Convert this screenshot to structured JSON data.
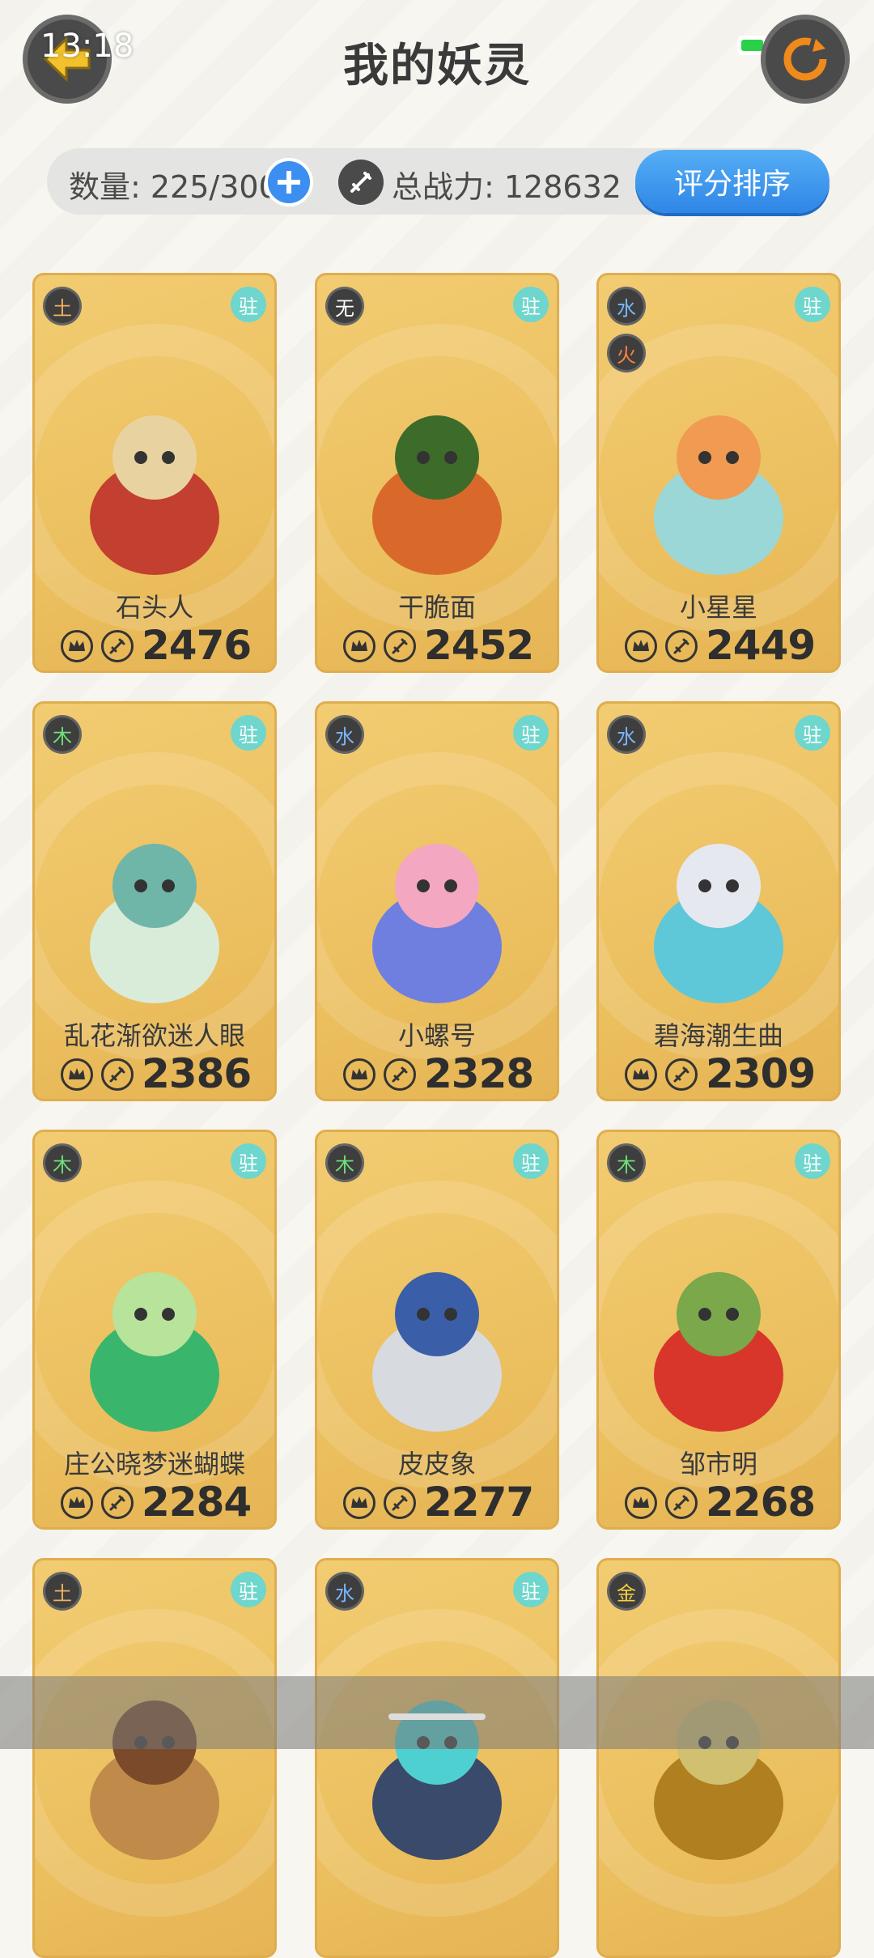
{
  "status": {
    "time": "13:18",
    "battery": "70"
  },
  "header": {
    "title": "我的妖灵"
  },
  "stats": {
    "count_label": "数量: 225/300",
    "power_label": "总战力: 128632",
    "sort_label": "评分排序"
  },
  "cards": [
    {
      "name": "石头人",
      "score": "2476",
      "elements": [
        "土"
      ],
      "tag": "驻",
      "colors": [
        "#c33f2f",
        "#e8d3a0"
      ]
    },
    {
      "name": "干脆面",
      "score": "2452",
      "elements": [
        "无"
      ],
      "tag": "驻",
      "colors": [
        "#d9692b",
        "#3d6b2a"
      ]
    },
    {
      "name": "小星星",
      "score": "2449",
      "elements": [
        "水",
        "火"
      ],
      "tag": "驻",
      "colors": [
        "#9bd7d7",
        "#f19a52"
      ]
    },
    {
      "name": "乱花渐欲迷人眼",
      "score": "2386",
      "elements": [
        "木"
      ],
      "tag": "驻",
      "colors": [
        "#d9ecd9",
        "#6fb6a8"
      ]
    },
    {
      "name": "小螺号",
      "score": "2328",
      "elements": [
        "水"
      ],
      "tag": "驻",
      "colors": [
        "#6f7fe0",
        "#f4a7c0"
      ]
    },
    {
      "name": "碧海潮生曲",
      "score": "2309",
      "elements": [
        "水"
      ],
      "tag": "驻",
      "colors": [
        "#5fc8d8",
        "#e6e8f0"
      ]
    },
    {
      "name": "庄公晓梦迷蝴蝶",
      "score": "2284",
      "elements": [
        "木"
      ],
      "tag": "驻",
      "colors": [
        "#39b66b",
        "#b7e39a"
      ]
    },
    {
      "name": "皮皮象",
      "score": "2277",
      "elements": [
        "木"
      ],
      "tag": "驻",
      "colors": [
        "#d7dbe0",
        "#3a5fa8"
      ]
    },
    {
      "name": "邹市明",
      "score": "2268",
      "elements": [
        "木"
      ],
      "tag": "驻",
      "colors": [
        "#d8362a",
        "#7aa84a"
      ]
    },
    {
      "name": "",
      "score": "",
      "elements": [
        "土"
      ],
      "tag": "驻",
      "colors": [
        "#c08a4a",
        "#7a4a2a"
      ]
    },
    {
      "name": "",
      "score": "",
      "elements": [
        "水"
      ],
      "tag": "驻",
      "colors": [
        "#3a4a6a",
        "#4fd0d0"
      ]
    },
    {
      "name": "",
      "score": "",
      "elements": [
        "金"
      ],
      "tag": "",
      "colors": [
        "#b08020",
        "#d0c070"
      ]
    }
  ]
}
